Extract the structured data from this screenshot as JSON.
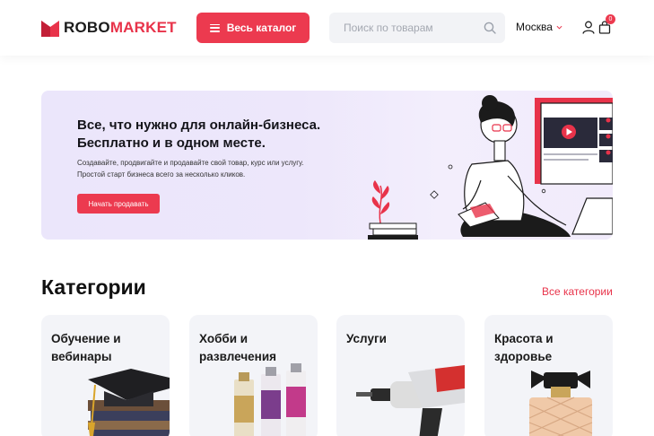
{
  "header": {
    "logo_part1": "ROBO",
    "logo_part2": "MARKET",
    "catalog_label": "Весь каталог",
    "search_placeholder": "Поиск по товарам",
    "city": "Москва",
    "cart_count": "0"
  },
  "banner": {
    "title_line1": "Все, что нужно для онлайн-бизнеса.",
    "title_line2": "Бесплатно и в одном месте.",
    "text_line1": "Создавайте, продвигайте и продавайте свой товар, курс или услугу.",
    "text_line2": "Простой старт бизнеса всего за несколько кликов.",
    "button_label": "Начать продавать"
  },
  "categories": {
    "title": "Категории",
    "all_link": "Все категории",
    "items": [
      {
        "label": "Обучение и вебинары"
      },
      {
        "label": "Хобби и развлечения"
      },
      {
        "label": "Услуги"
      },
      {
        "label": "Красота и здоровье"
      }
    ]
  },
  "colors": {
    "accent": "#ec3a4f",
    "banner_bg": "#ece6fb",
    "card_bg": "#f3f4f8"
  }
}
